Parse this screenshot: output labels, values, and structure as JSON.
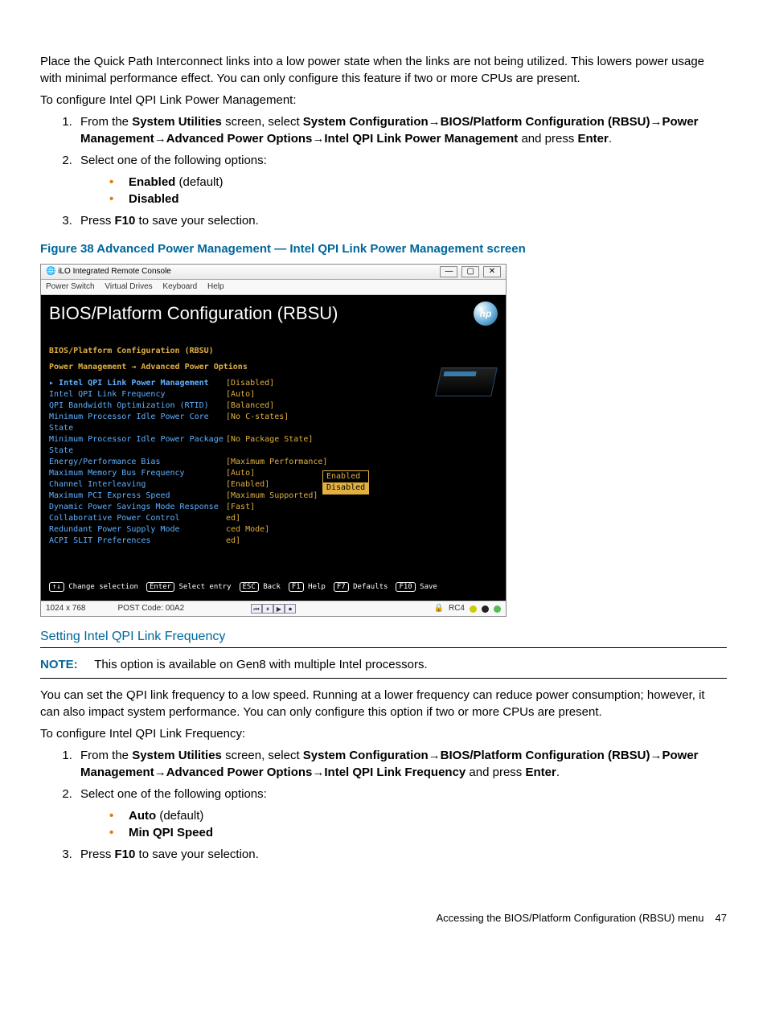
{
  "section1": {
    "intro": "Place the Quick Path Interconnect links into a low power state when the links are not being utilized. This lowers power usage with minimal performance effect. You can only configure this feature if two or more CPUs are present.",
    "lead": "To configure Intel QPI Link Power Management:",
    "step1_pre": "From the ",
    "step1_sysutil": "System Utilities",
    "step1_mid1": " screen, select ",
    "step1_syscfg": "System Configuration",
    "step1_bios": "BIOS/Platform Configuration (RBSU)",
    "step1_power": "Power Management",
    "step1_adv": "Advanced Power Options",
    "step1_qpi": "Intel QPI Link Power Management",
    "step1_end_a": " and press ",
    "step1_enter": "Enter",
    "step1_end_b": ".",
    "step2": "Select one of the following options:",
    "opt1_b": "Enabled",
    "opt1_t": " (default)",
    "opt2_b": "Disabled",
    "step3_a": "Press ",
    "step3_b": "F10",
    "step3_c": " to save your selection."
  },
  "figure_caption": "Figure 38 Advanced Power Management — Intel QPI Link Power Management screen",
  "bios": {
    "window_title": "iLO Integrated Remote Console",
    "minimize": "—",
    "maximize": "▢",
    "close": "✕",
    "menu": {
      "power": "Power Switch",
      "vd": "Virtual Drives",
      "kb": "Keyboard",
      "help": "Help"
    },
    "title": "BIOS/Platform Configuration (RBSU)",
    "hp": "hp",
    "cfg_head": "BIOS/Platform Configuration (RBSU)",
    "breadcrumb": "Power Management → Advanced Power Options",
    "rows": [
      {
        "label": "Intel QPI Link Power Management",
        "val": "[Disabled]",
        "sel": true
      },
      {
        "label": "Intel QPI Link Frequency",
        "val": "[Auto]"
      },
      {
        "label": "QPI Bandwidth Optimization (RTID)",
        "val": "[Balanced]"
      },
      {
        "label": "Minimum Processor Idle Power Core State",
        "val": "[No C-states]"
      },
      {
        "label": "Minimum Processor Idle Power Package State",
        "val": "[No Package State]"
      },
      {
        "label": "Energy/Performance Bias",
        "val": "[Maximum Performance]"
      },
      {
        "label": "Maximum Memory Bus Frequency",
        "val": "[Auto]"
      },
      {
        "label": "Channel Interleaving",
        "val": "[Enabled]"
      },
      {
        "label": "Maximum PCI Express Speed",
        "val": "[Maximum Supported]"
      },
      {
        "label": "Dynamic Power Savings Mode Response",
        "val": "[Fast]"
      },
      {
        "label": "Collaborative Power Control",
        "val": "ed]"
      },
      {
        "label": "Redundant Power Supply Mode",
        "val": "ced Mode]"
      },
      {
        "label": "ACPI SLIT Preferences",
        "val": "ed]"
      }
    ],
    "dropdown": {
      "enabled": "Enabled",
      "disabled": "Disabled"
    },
    "fn": {
      "updn": "↑↓",
      "updn_t": "Change selection",
      "enter": "Enter",
      "enter_t": "Select entry",
      "esc": "ESC",
      "esc_t": "Back",
      "f1": "F1",
      "f1_t": "Help",
      "f7": "F7",
      "f7_t": "Defaults",
      "f10": "F10",
      "f10_t": "Save"
    },
    "status": {
      "res": "1024 x 768",
      "post": "POST Code: 00A2",
      "rc4": "RC4"
    }
  },
  "section2": {
    "heading": "Setting Intel QPI Link Frequency",
    "note_label": "NOTE:",
    "note_text": "This option is available on Gen8 with multiple Intel processors.",
    "intro": "You can set the QPI link frequency to a low speed. Running at a lower frequency can reduce power consumption; however, it can also impact system performance. You can only configure this option if two or more CPUs are present.",
    "lead": "To configure Intel QPI Link Frequency:",
    "step1_pre": "From the ",
    "step1_sysutil": "System Utilities",
    "step1_mid1": " screen, select ",
    "step1_syscfg": "System Configuration",
    "step1_bios": "BIOS/Platform Configuration (RBSU)",
    "step1_power": "Power Management",
    "step1_adv": "Advanced Power Options",
    "step1_qpi": "Intel QPI Link Frequency",
    "step1_end_a": " and press ",
    "step1_enter": "Enter",
    "step1_end_b": ".",
    "step2": "Select one of the following options:",
    "opt1_b": "Auto",
    "opt1_t": " (default)",
    "opt2_b": "Min QPI Speed",
    "step3_a": "Press ",
    "step3_b": "F10",
    "step3_c": " to save your selection."
  },
  "footer": {
    "text": "Accessing the BIOS/Platform Configuration (RBSU) menu",
    "page": "47"
  },
  "arrow": "→"
}
